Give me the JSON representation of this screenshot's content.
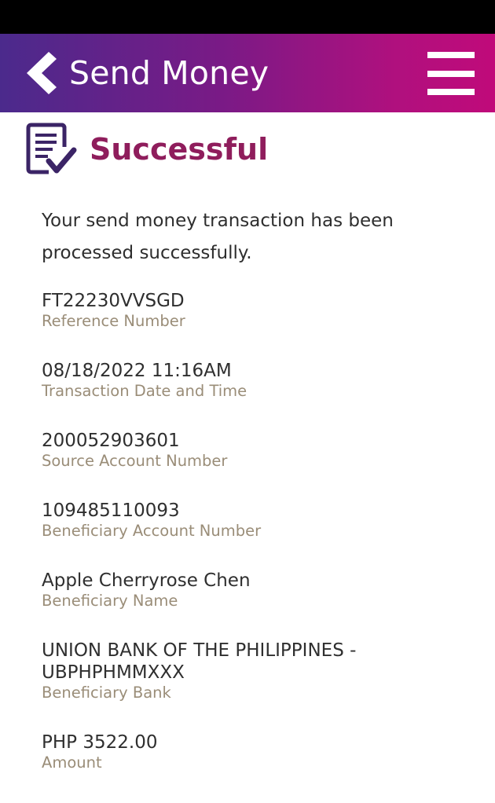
{
  "header": {
    "title": "Send Money",
    "back_icon": "chevron-left-icon",
    "menu_icon": "hamburger-menu-icon"
  },
  "status": {
    "icon": "document-check-icon",
    "title": "Successful"
  },
  "message": "Your send money transaction has been processed successfully.",
  "details": [
    {
      "value": "FT22230VVSGD",
      "label": "Reference Number"
    },
    {
      "value": "08/18/2022 11:16AM",
      "label": "Transaction Date and Time"
    },
    {
      "value": "200052903601",
      "label": "Source Account Number"
    },
    {
      "value": "109485110093",
      "label": "Beneficiary Account Number"
    },
    {
      "value": "Apple Cherryrose Chen",
      "label": "Beneficiary Name"
    },
    {
      "value": "UNION BANK OF THE PHILIPPINES - UBPHPHMMXXX",
      "label": "Beneficiary Bank"
    },
    {
      "value": "PHP 3522.00",
      "label": "Amount"
    }
  ],
  "colors": {
    "header_gradient_start": "#4b2a8c",
    "header_gradient_end": "#c00a7a",
    "success_title": "#8f1d5c",
    "icon": "#3b2466",
    "label": "#9a8d78",
    "value": "#2f2f2f"
  }
}
